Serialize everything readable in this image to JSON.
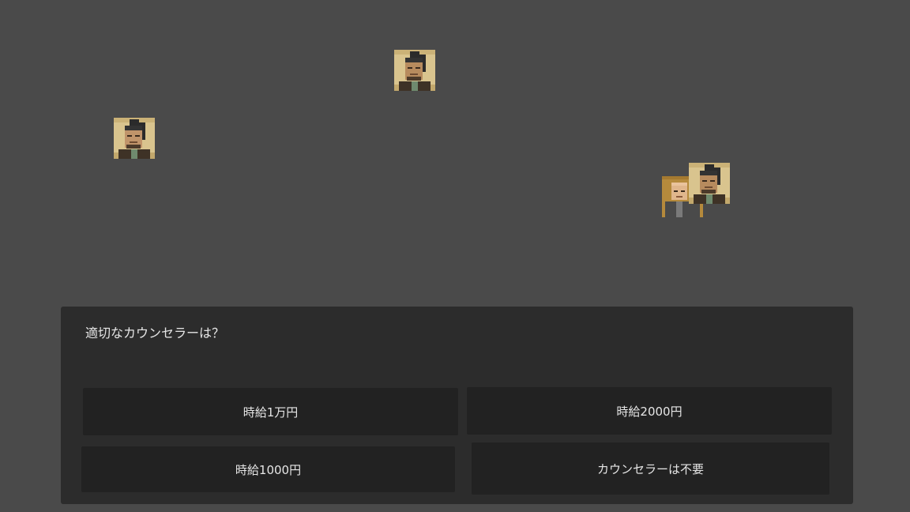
{
  "dialog": {
    "question": "適切なカウンセラーは？",
    "choices": [
      "時給1万円",
      "時給2000円",
      "時給1000円",
      "カウンセラーは不要"
    ]
  },
  "colors": {
    "background": "#4a4a4a",
    "dialog_bg": "#2c2c2c",
    "button_bg": "#222222",
    "text": "#e6e6e6",
    "portrait_parchment": "#d9c48e",
    "portrait_gold": "#b58a3c"
  },
  "characters": [
    {
      "name": "courtier-portrait-top"
    },
    {
      "name": "courtier-portrait-left"
    },
    {
      "name": "monk-portrait"
    },
    {
      "name": "courtier-portrait-right"
    }
  ]
}
